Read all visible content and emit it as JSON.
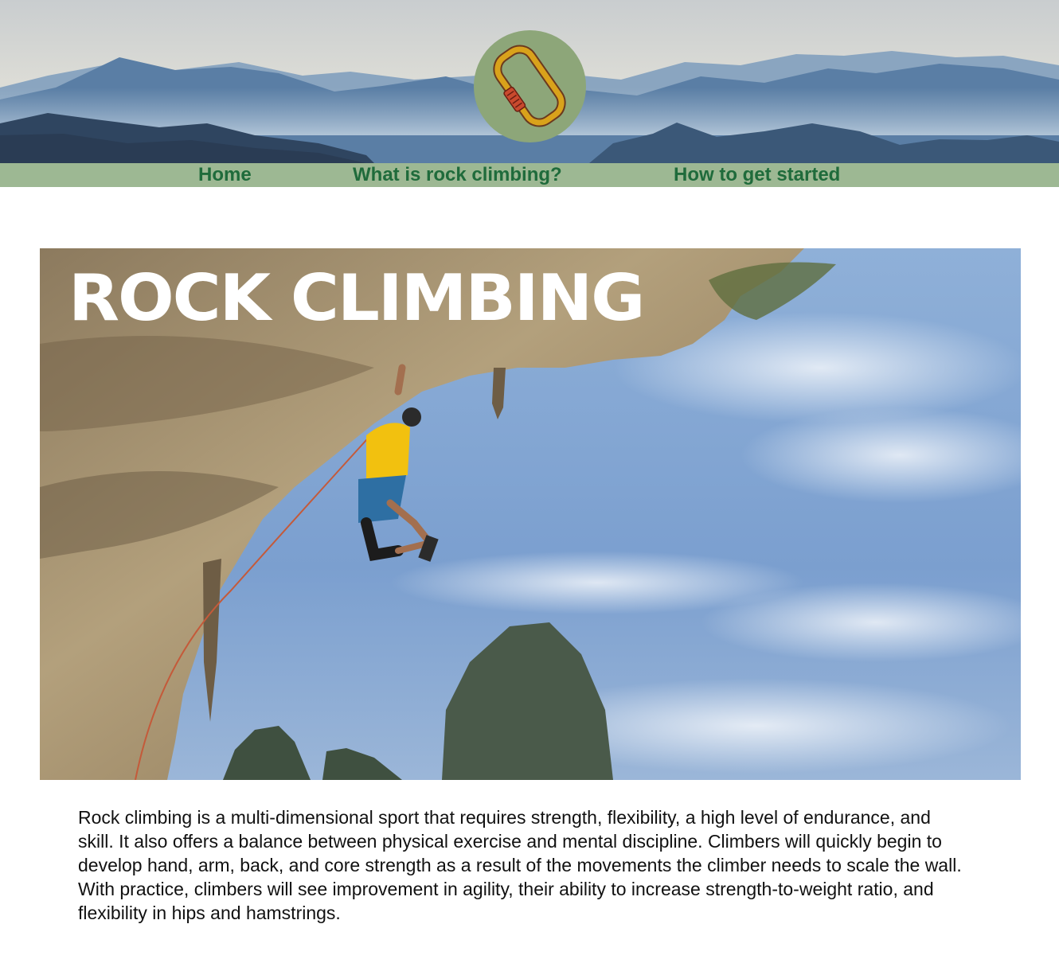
{
  "header": {
    "banner_image": "misty-blue-mountain-range",
    "logo_icon": "carabiner-icon",
    "colors": {
      "logo_circle": "#8da679",
      "carabiner": "#d9a21b",
      "carabiner_lock": "#c94a2e"
    }
  },
  "nav": {
    "background": "#9db893",
    "text_color": "#1f6b3b",
    "items": [
      {
        "label": "Home"
      },
      {
        "label": "What is rock climbing?"
      },
      {
        "label": "How to get started"
      }
    ]
  },
  "hero": {
    "image": "climber-on-overhanging-cliff",
    "title": "ROCK CLIMBING"
  },
  "intro": {
    "text": "Rock climbing is a multi-dimensional sport that requires strength, flexibility, a high level of endurance, and skill. It also offers a balance between physical exercise and mental discipline. Climbers will quickly begin to develop hand, arm, back, and core strength as a result of the movements the climber needs to scale the wall. With practice, climbers will see improvement in agility, their ability to increase strength-to-weight ratio, and flexibility in hips and hamstrings."
  }
}
